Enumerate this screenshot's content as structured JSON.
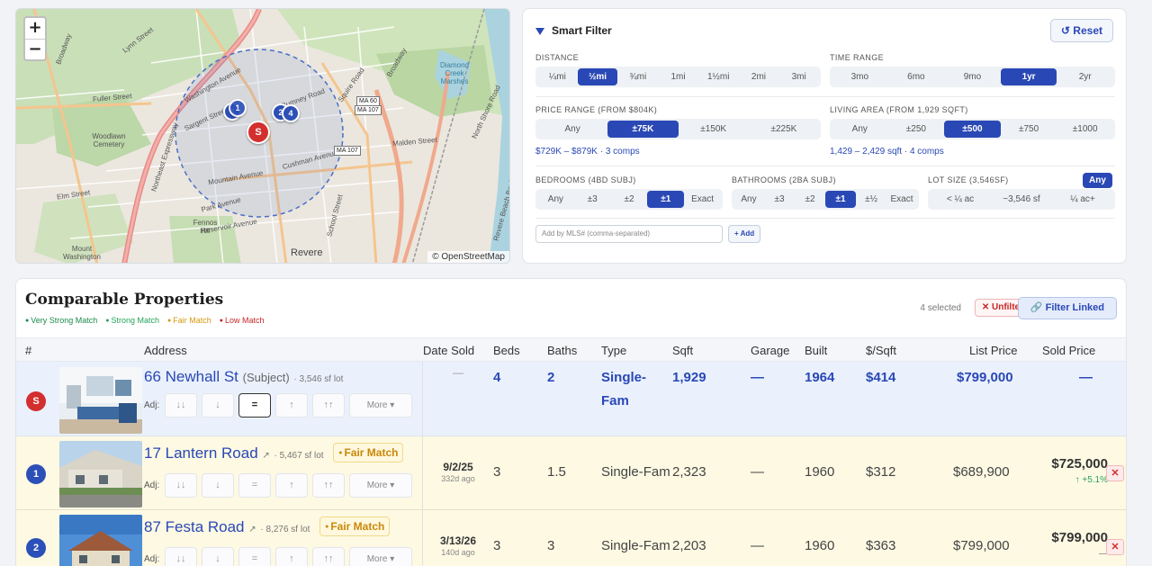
{
  "map": {
    "zoom_in": "+",
    "zoom_out": "−",
    "attribution": "© OpenStreetMap",
    "labels": {
      "lynn": "Lynn Street",
      "broadway1": "Broadway",
      "fuller": "Fuller Street",
      "woodlawn": "Woodlawn Cemetery",
      "washington": "Washington Avenue",
      "sargent": "Sargent Street",
      "rumney": "Rumney Road",
      "squire": "Squire Road",
      "broadway2": "Broadway",
      "diamond": "Diamond Creek Marshes",
      "northshore": "North Shore Road",
      "northeast": "Northeast Expressway",
      "malden": "Malden Street",
      "cushman": "Cushman Avenue",
      "mountain": "Mountain Avenue",
      "park": "Park Avenue",
      "elm": "Elm Street",
      "reservoir": "Reservoir Avenue",
      "fennos": "Fennos Hill",
      "mtwashington": "Mount Washington",
      "revere": "Revere",
      "beachblvd": "Revere Beach Boulevard",
      "school": "School Street",
      "hwy_a": "MA 60",
      "hwy_b": "MA 107",
      "hwy_c": "MA 107"
    },
    "pins": [
      {
        "label": "3"
      },
      {
        "label": "1"
      },
      {
        "label": "2"
      },
      {
        "label": "4"
      },
      {
        "label": "S"
      }
    ]
  },
  "filter": {
    "title": "Smart Filter",
    "reset": "↺ Reset",
    "distance": {
      "label": "DISTANCE",
      "options": [
        "¼mi",
        "½mi",
        "¾mi",
        "1mi",
        "1½mi",
        "2mi",
        "3mi"
      ],
      "selected": "½mi"
    },
    "time_range": {
      "label": "TIME RANGE",
      "options": [
        "3mo",
        "6mo",
        "9mo",
        "1yr",
        "2yr"
      ],
      "selected": "1yr"
    },
    "price_range": {
      "label": "PRICE RANGE (FROM $804K)",
      "options": [
        "Any",
        "±75K",
        "±150K",
        "±225K"
      ],
      "selected": "±75K",
      "summary": "$729K – $879K · 3 comps"
    },
    "living_area": {
      "label": "LIVING AREA (FROM 1,929 SQFT)",
      "options": [
        "Any",
        "±250",
        "±500",
        "±750",
        "±1000"
      ],
      "selected": "±500",
      "summary": "1,429 – 2,429 sqft · 4 comps"
    },
    "bedrooms": {
      "label": "BEDROOMS (4BD SUBJ)",
      "options": [
        "Any",
        "±3",
        "±2",
        "±1",
        "Exact"
      ],
      "selected": "±1"
    },
    "bathrooms": {
      "label": "BATHROOMS (2BA SUBJ)",
      "options": [
        "Any",
        "±3",
        "±2",
        "±1",
        "±½",
        "Exact"
      ],
      "selected": "±1"
    },
    "lot_size": {
      "label": "LOT SIZE (3,546SF)",
      "any_badge": "Any",
      "options": [
        "< ¼ ac",
        "~3,546 sf",
        "¼ ac+"
      ]
    },
    "mls_placeholder": "Add by MLS# (comma-separated)",
    "add_button": "+ Add"
  },
  "comps": {
    "title": "Comparable Properties",
    "legend": [
      "Very Strong Match",
      "Strong Match",
      "Fair Match",
      "Low Match"
    ],
    "selected_count": "4 selected",
    "unfilter": "✕ Unfilter",
    "filter_linked": "🔗 Filter Linked",
    "headers": {
      "num": "#",
      "address": "Address",
      "date": "Date Sold",
      "beds": "Beds",
      "baths": "Baths",
      "type": "Type",
      "sqft": "Sqft",
      "garage": "Garage",
      "built": "Built",
      "ppsf": "$/Sqft",
      "list": "List Price",
      "sold": "Sold Price"
    },
    "adj_label": "Adj:",
    "adj_buttons": [
      "↓↓",
      "↓",
      "=",
      "↑",
      "↑↑"
    ],
    "more": "More ▾",
    "subject": {
      "badge": "S",
      "address": "66 Newhall St",
      "tag": "(Subject)",
      "lot": "· 3,546 sf lot",
      "date": "—",
      "beds": "4",
      "baths": "2",
      "type_line1": "Single-",
      "type_line2": "Fam",
      "sqft": "1,929",
      "garage": "—",
      "built": "1964",
      "ppsf": "$414",
      "list": "$799,000",
      "sold": "—"
    },
    "rows": [
      {
        "badge": "1",
        "address": "17 Lantern Road",
        "link": "↗",
        "lot": "· 5,467 sf lot",
        "match": "Fair Match",
        "date": "9/2/25",
        "ago": "332d ago",
        "beds": "3",
        "baths": "1.5",
        "type": "Single-Fam",
        "sqft": "2,323",
        "garage": "—",
        "built": "1960",
        "ppsf": "$312",
        "list": "$689,900",
        "sold": "$725,000",
        "delta": "↑ +5.1%",
        "remove": "✕"
      },
      {
        "badge": "2",
        "address": "87 Festa Road",
        "link": "↗",
        "lot": "· 8,276 sf lot",
        "match": "Fair Match",
        "date": "3/13/26",
        "ago": "140d ago",
        "beds": "3",
        "baths": "3",
        "type": "Single-Fam",
        "sqft": "2,203",
        "garage": "—",
        "built": "1960",
        "ppsf": "$363",
        "list": "$799,000",
        "sold": "$799,000",
        "delta": "—",
        "remove": "✕"
      }
    ]
  }
}
